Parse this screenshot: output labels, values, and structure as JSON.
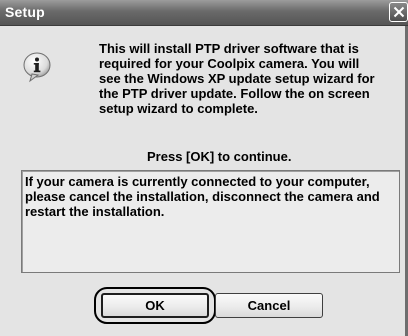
{
  "window": {
    "title": "Setup"
  },
  "icons": {
    "title_close": "close-icon",
    "message_icon": "info-icon"
  },
  "message": {
    "lines": [
      "This will install PTP driver software that is",
      "required for your Coolpix camera. You will",
      "see the Windows XP update setup wizard for",
      "the PTP driver update. Follow the on screen",
      "setup wizard to complete."
    ],
    "prompt": "Press [OK] to continue."
  },
  "notice": {
    "lines": [
      "If your camera is currently connected to your computer,",
      "please cancel the installation, disconnect the camera and",
      "restart the installation."
    ]
  },
  "buttons": {
    "ok_label": "OK",
    "cancel_label": "Cancel"
  }
}
